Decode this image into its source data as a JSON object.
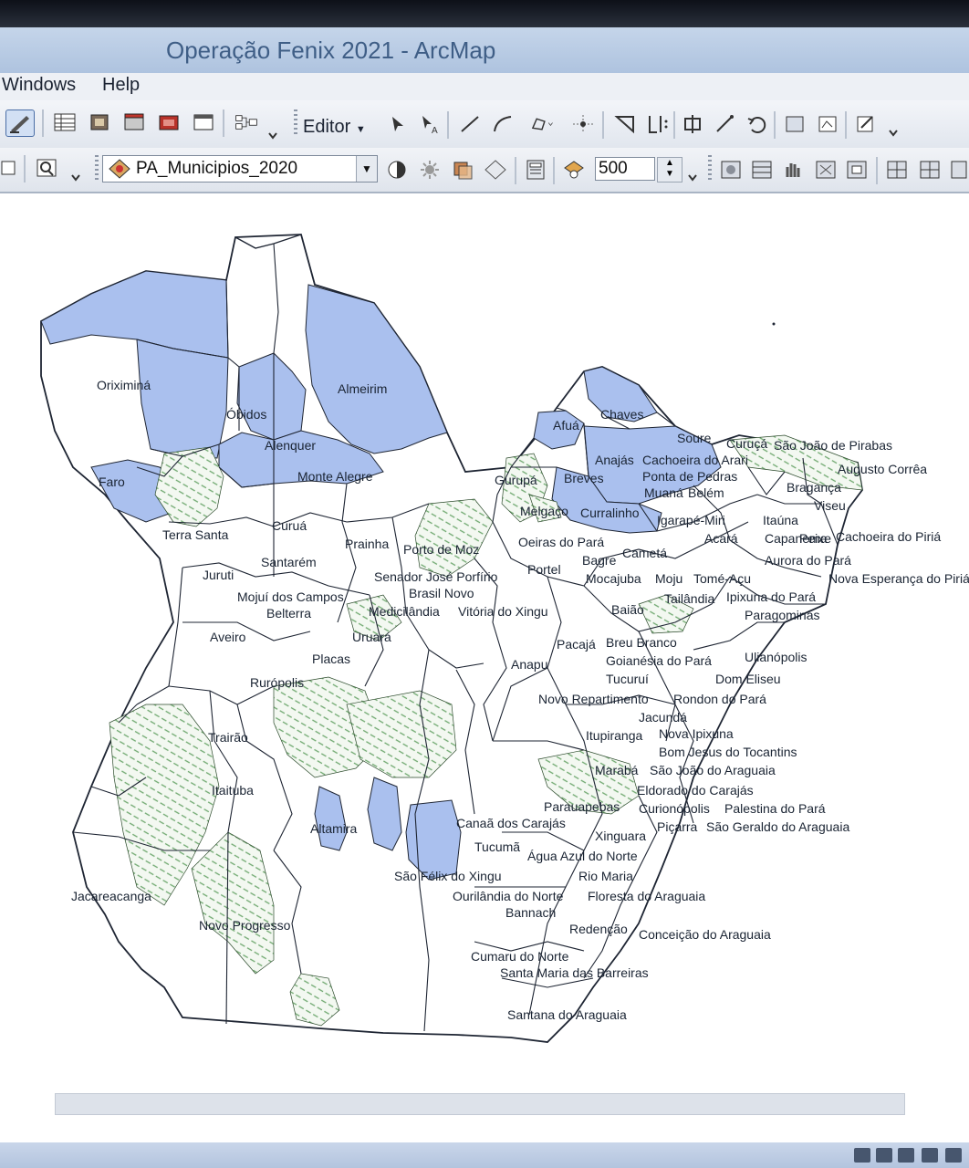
{
  "window": {
    "title": "Operação Fenix 2021 - ArcMap"
  },
  "menubar": {
    "items": [
      "Windows",
      "Help"
    ]
  },
  "toolbar": {
    "editor_label": "Editor"
  },
  "layer_selector": {
    "value": "PA_Municipios_2020"
  },
  "scale": {
    "value": "500"
  },
  "colors": {
    "selected_fill": "#aac0ee",
    "boundary": "#1e2533",
    "hatch_green": "#6fa86f",
    "map_background": "#ffffff",
    "title_text": "#3f5e86"
  },
  "map": {
    "labels": [
      "Oriximiná",
      "Óbidos",
      "Almeirim",
      "Alenquer",
      "Monte Alegre",
      "Faro",
      "Terra Santa",
      "Curuá",
      "Santarém",
      "Juruti",
      "Mojuí dos Campos",
      "Belterra",
      "Aveiro",
      "Placas",
      "Rurópolis",
      "Prainha",
      "Porto de Moz",
      "Senador José Porfírio",
      "Brasil Novo",
      "Medicilândia",
      "Vitória do Xingu",
      "Uruará",
      "Anapu",
      "Portel",
      "Gurupá",
      "Melgaço",
      "Chaves",
      "Anajás",
      "Breves",
      "Curralinho",
      "Afuá",
      "Soure",
      "Cachoeira do Arari",
      "Ponta de Pedras",
      "Muaná",
      "Belém",
      "Curuçá",
      "São João de Pirabas",
      "Augusto Corrêa",
      "Bragança",
      "Viseu",
      "Cachoeira do Piriá",
      "Capanema",
      "Aurora do Pará",
      "Nova Esperança do Piriá",
      "Oeiras do Pará",
      "Bagre",
      "Cametá",
      "Mocajuba",
      "Moju",
      "Tomé-Açu",
      "Igarapé-Miri",
      "Acará",
      "Tailândia",
      "Ipixuna do Pará",
      "Paragominas",
      "Baião",
      "Pacajá",
      "Breu Branco",
      "Goianésia do Pará",
      "Ulianópolis",
      "Tucuruí",
      "Dom Eliseu",
      "Novo Repartimento",
      "Rondon do Pará",
      "Jacundá",
      "Itupiranga",
      "Nova Ipixuna",
      "Bom Jesus do Tocantins",
      "Marabá",
      "São João do Araguaia",
      "Eldorado do Carajás",
      "Parauapebas",
      "Curionópolis",
      "Palestina do Pará",
      "Canaã dos Carajás",
      "Piçarra",
      "São Geraldo do Araguaia",
      "Xinguara",
      "Tucumã",
      "Água Azul do Norte",
      "Rio Maria",
      "São Félix do Xingu",
      "Ourilândia do Norte",
      "Floresta do Araguaia",
      "Bannach",
      "Redenção",
      "Conceição do Araguaia",
      "Cumaru do Norte",
      "Santa Maria das Barreiras",
      "Santana do Araguaia",
      "Trairão",
      "Itaituba",
      "Altamira",
      "Jacareacanga",
      "Novo Progresso",
      "Itaúna",
      "Peixe"
    ]
  }
}
